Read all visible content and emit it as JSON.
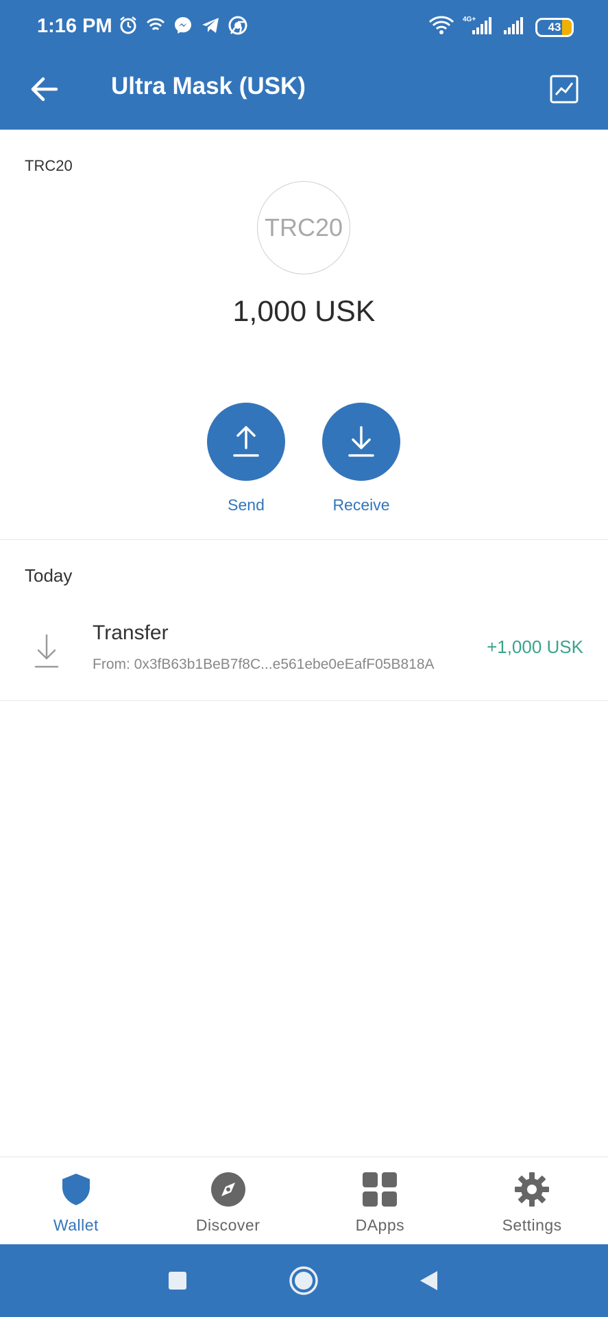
{
  "status": {
    "time": "1:16 PM",
    "battery": "43",
    "icons_left": [
      "alarm-icon",
      "wifi-calling-icon",
      "messenger-icon",
      "telegram-icon",
      "chrome-icon"
    ],
    "icons_right": [
      "wifi-icon",
      "signal-4g-icon",
      "signal-icon",
      "battery-icon"
    ]
  },
  "appbar": {
    "title": "Ultra Mask (USK)",
    "back_icon": "arrow-left-icon",
    "chart_icon": "line-chart-icon"
  },
  "token": {
    "network": "TRC20",
    "logo_text": "TRC20",
    "balance": "1,000 USK"
  },
  "actions": {
    "send_label": "Send",
    "receive_label": "Receive"
  },
  "transactions": {
    "section": "Today",
    "items": [
      {
        "title": "Transfer",
        "from": "From: 0x3fB63b1BeB7f8C...e561ebe0eEafF05B818A",
        "amount": "+1,000 USK",
        "icon": "arrow-down-icon"
      }
    ]
  },
  "tabs": [
    {
      "label": "Wallet",
      "icon": "shield-icon",
      "active": true
    },
    {
      "label": "Discover",
      "icon": "compass-icon",
      "active": false
    },
    {
      "label": "DApps",
      "icon": "grid-icon",
      "active": false
    },
    {
      "label": "Settings",
      "icon": "gear-icon",
      "active": false
    }
  ],
  "colors": {
    "primary": "#3375bb",
    "positive": "#3aa489",
    "battery_fill": "#f0b000"
  }
}
